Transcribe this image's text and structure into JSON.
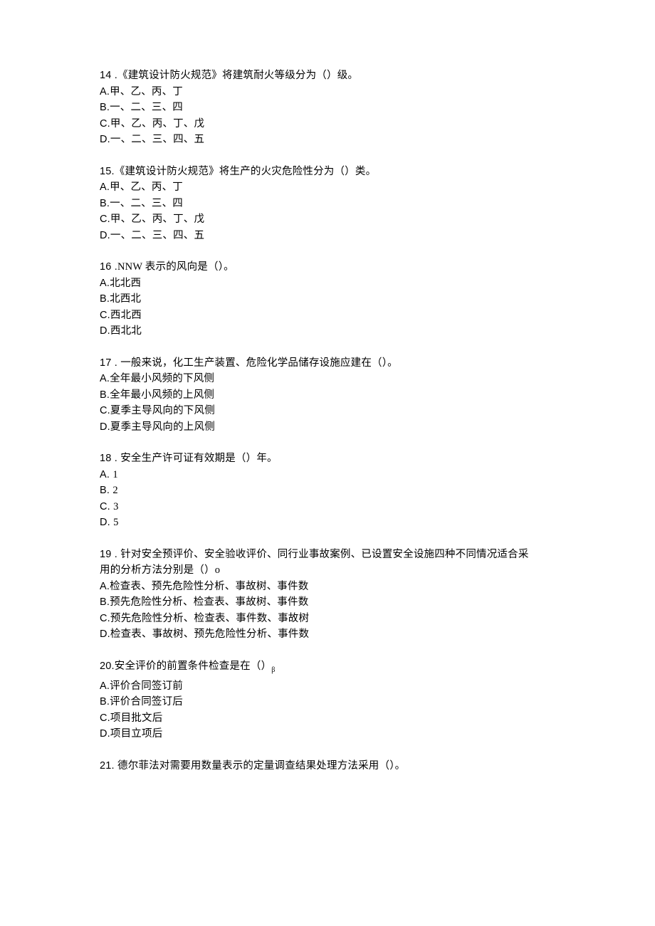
{
  "questions": [
    {
      "number": "14",
      "sep": " .",
      "text": "《建筑设计防火规范》将建筑耐火等级分为（）级。",
      "options": [
        {
          "label": "A.",
          "text": "甲、乙、丙、丁"
        },
        {
          "label": "B.",
          "text": "一、二、三、四"
        },
        {
          "label": "C.",
          "text": "甲、乙、丙、丁、戊"
        },
        {
          "label": "D.",
          "text": "一、二、三、四、五"
        }
      ]
    },
    {
      "number": "15.",
      "sep": "",
      "text": "《建筑设计防火规范》将生产的火灾危险性分为（）类。",
      "options": [
        {
          "label": "A.",
          "text": "甲、乙、丙、丁"
        },
        {
          "label": "B.",
          "text": "一、二、三、四"
        },
        {
          "label": "C.",
          "text": "甲、乙、丙、丁、戊"
        },
        {
          "label": "D.",
          "text": "一、二、三、四、五"
        }
      ]
    },
    {
      "number": "16",
      "sep": " .",
      "text": "NNW 表示的风向是（）。",
      "options": [
        {
          "label": "A.",
          "text": "北北西"
        },
        {
          "label": "B.",
          "text": "北西北"
        },
        {
          "label": "C.",
          "text": "西北西"
        },
        {
          "label": "D.",
          "text": "西北北"
        }
      ]
    },
    {
      "number": "17",
      "sep": " . ",
      "text": "一般来说，化工生产装置、危险化学品储存设施应建在（）。",
      "options": [
        {
          "label": "A.",
          "text": "全年最小风频的下风侧"
        },
        {
          "label": "B.",
          "text": "全年最小风频的上风侧"
        },
        {
          "label": "C.",
          "text": "夏季主导风向的下风侧"
        },
        {
          "label": "D.",
          "text": "夏季主导风向的上风侧"
        }
      ]
    },
    {
      "number": "18",
      "sep": " . ",
      "text": "安全生产许可证有效期是（）年。",
      "options": [
        {
          "label": "A.   ",
          "text": "1"
        },
        {
          "label": "B.   ",
          "text": "2"
        },
        {
          "label": "C.   ",
          "text": "3"
        },
        {
          "label": "D.   ",
          "text": "5"
        }
      ]
    },
    {
      "number": "19",
      "sep": " . ",
      "text": "针对安全预评价、安全验收评价、同行业事故案例、已设置安全设施四种不同情况适合采",
      "text2": "用的分析方法分别是（）o",
      "options": [
        {
          "label": "A.",
          "text": "检查表、预先危险性分析、事故树、事件数"
        },
        {
          "label": "B.",
          "text": "预先危险性分析、检查表、事故树、事件数"
        },
        {
          "label": "C.",
          "text": "预先危险性分析、检查表、事件数、事故树"
        },
        {
          "label": "D.",
          "text": "检查表、事故树、预先危险性分析、事件数"
        }
      ]
    },
    {
      "number": "20.",
      "sep": "",
      "text": "安全评价的前置条件检查是在（）",
      "suffix": "β",
      "options": [
        {
          "label": "A.",
          "text": "评价合同签订前"
        },
        {
          "label": "B.",
          "text": "评价合同签订后"
        },
        {
          "label": "C.",
          "text": "项目批文后"
        },
        {
          "label": "D.",
          "text": "项目立项后"
        }
      ]
    },
    {
      "number": "21.",
      "sep": " ",
      "text": "德尔菲法对需要用数量表示的定量调查结果处理方法采用（）。",
      "options": []
    }
  ]
}
